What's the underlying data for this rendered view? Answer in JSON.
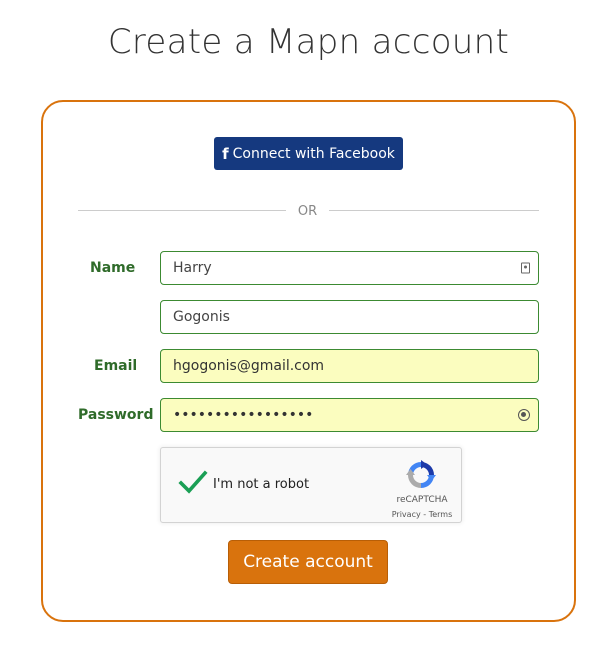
{
  "page": {
    "title": "Create a Mapn account"
  },
  "facebook": {
    "icon": "facebook-f-icon",
    "label": "Connect with Facebook",
    "color": "#15397f"
  },
  "divider": {
    "text": "OR"
  },
  "form": {
    "name_label": "Name",
    "first_name_value": "Harry",
    "last_name_value": "Gogonis",
    "email_label": "Email",
    "email_value": "hgogonis@gmail.com",
    "password_label": "Password",
    "password_value": "•••••••••••••••••",
    "field_border_color": "#3c8a32",
    "autofill_color": "#fbfdbf",
    "label_color": "#2f6b2a"
  },
  "recaptcha": {
    "label": "I'm not a robot",
    "checked": true,
    "brand": "reCAPTCHA",
    "privacy_link": "Privacy",
    "separator": " - ",
    "terms_link": "Terms"
  },
  "submit": {
    "label": "Create account",
    "color": "#d9730d"
  },
  "theme": {
    "card_border_color": "#d9730d"
  }
}
